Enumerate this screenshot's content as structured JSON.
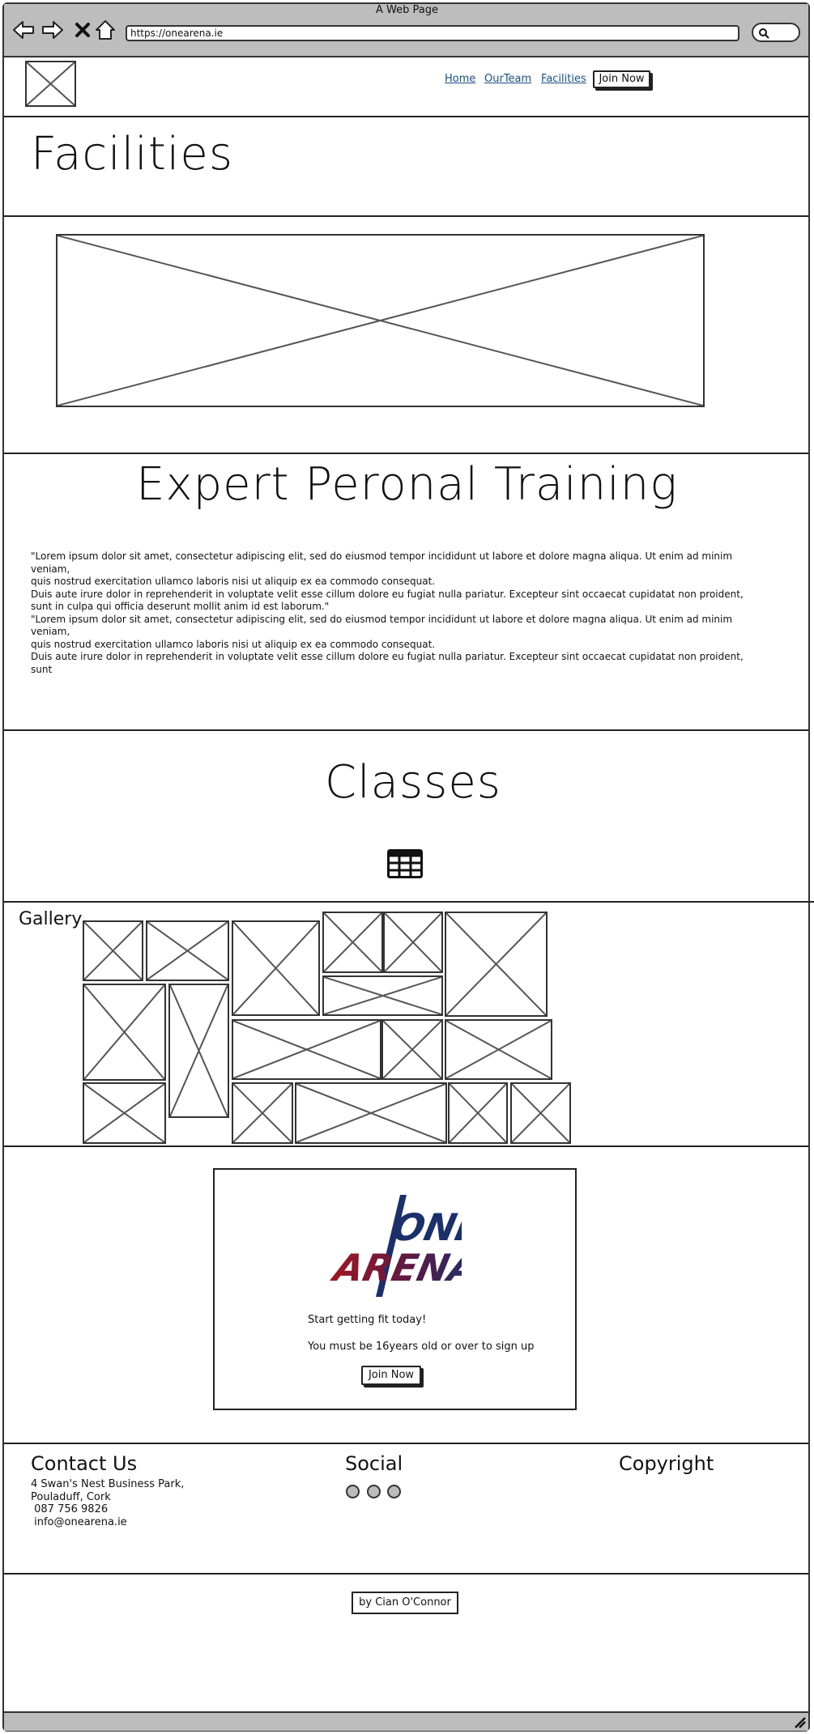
{
  "window": {
    "title": "A Web Page",
    "url": "https://onearena.ie"
  },
  "nav": {
    "home": "Home",
    "team": "OurTeam",
    "facilities": "Facilities",
    "join": "Join Now"
  },
  "page_title": "Facilities",
  "training": {
    "heading": "Expert Peronal Training",
    "lines": [
      "\"Lorem ipsum dolor sit amet, consectetur adipiscing elit, sed do eiusmod tempor incididunt ut labore et dolore magna aliqua. Ut enim ad minim veniam,",
      "quis nostrud exercitation ullamco laboris nisi ut aliquip ex ea commodo consequat.",
      "Duis aute irure dolor in reprehenderit in voluptate velit esse cillum dolore eu fugiat nulla pariatur. Excepteur sint occaecat cupidatat non proident, sunt in culpa qui officia deserunt mollit anim id est laborum.\"",
      "\"Lorem ipsum dolor sit amet, consectetur adipiscing elit, sed do eiusmod tempor incididunt ut labore et dolore magna aliqua. Ut enim ad minim veniam,",
      "quis nostrud exercitation ullamco laboris nisi ut aliquip ex ea commodo consequat.",
      "Duis aute irure dolor in reprehenderit in voluptate velit esse cillum dolore eu fugiat nulla pariatur. Excepteur sint occaecat cupidatat non proident, sunt"
    ]
  },
  "classes": {
    "heading": "Classes",
    "icon": "table-grid-icon"
  },
  "gallery": {
    "label": "Gallery"
  },
  "signup": {
    "logo_line1": "ONE",
    "logo_line2": "ARENA",
    "tagline": "Start getting fit today!",
    "age_note": "You must be 16years old or over to sign up",
    "button": "Join Now",
    "colors": {
      "navy": "#1b2f6b",
      "red": "#9c1622"
    }
  },
  "footer": {
    "contact": {
      "heading": "Contact Us",
      "address1": "4 Swan's Nest Business Park,",
      "address2": "Pouladuff, Cork",
      "phone": " 087 756 9826",
      "email": " info@onearena.ie"
    },
    "social": {
      "heading": "Social"
    },
    "copyright": {
      "heading": "Copyright"
    }
  },
  "credit": "by Cian O'Connor"
}
